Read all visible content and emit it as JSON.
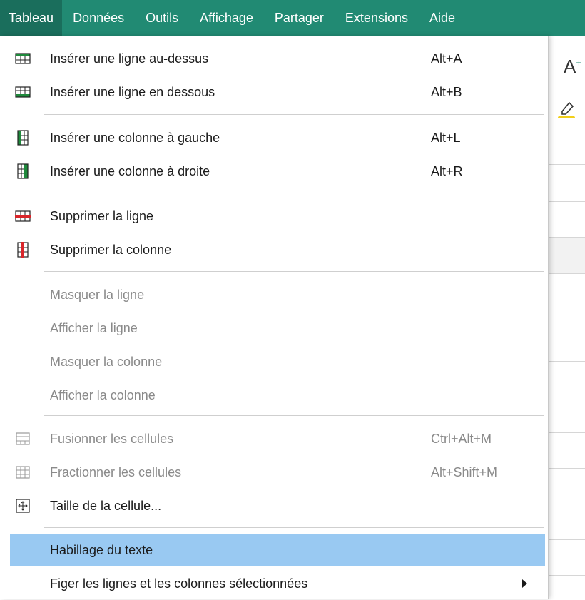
{
  "menubar": {
    "items": [
      "Tableau",
      "Données",
      "Outils",
      "Affichage",
      "Partager",
      "Extensions",
      "Aide"
    ]
  },
  "colors": {
    "menubar_bg": "#218a73",
    "menubar_active_bg": "#1a6e5c",
    "highlight": "#99c9f2",
    "icon_green": "#1f8a3c",
    "icon_red": "#d9252a"
  },
  "menu": {
    "insert_row_above": {
      "label": "Insérer une ligne au-dessus",
      "shortcut": "Alt+A",
      "icon": "insert-row-above-icon"
    },
    "insert_row_below": {
      "label": "Insérer une ligne en dessous",
      "shortcut": "Alt+B",
      "icon": "insert-row-below-icon"
    },
    "insert_col_left": {
      "label": "Insérer une colonne à gauche",
      "shortcut": "Alt+L",
      "icon": "insert-column-left-icon"
    },
    "insert_col_right": {
      "label": "Insérer une colonne à droite",
      "shortcut": "Alt+R",
      "icon": "insert-column-right-icon"
    },
    "delete_row": {
      "label": "Supprimer la ligne",
      "icon": "delete-row-icon"
    },
    "delete_col": {
      "label": "Supprimer la colonne",
      "icon": "delete-column-icon"
    },
    "hide_row": {
      "label": "Masquer la ligne"
    },
    "show_row": {
      "label": "Afficher la ligne"
    },
    "hide_col": {
      "label": "Masquer la colonne"
    },
    "show_col": {
      "label": "Afficher la colonne"
    },
    "merge_cells": {
      "label": "Fusionner les cellules",
      "shortcut": "Ctrl+Alt+M",
      "icon": "merge-cells-icon"
    },
    "split_cells": {
      "label": "Fractionner les cellules",
      "shortcut": "Alt+Shift+M",
      "icon": "split-cells-icon"
    },
    "cell_size": {
      "label": "Taille de la cellule...",
      "icon": "cell-size-icon"
    },
    "text_wrap": {
      "label": "Habillage du texte"
    },
    "freeze": {
      "label": "Figer les lignes et les colonnes sélectionnées"
    }
  },
  "toolbar": {
    "font_grow": "A",
    "font_grow_sup": "+"
  }
}
